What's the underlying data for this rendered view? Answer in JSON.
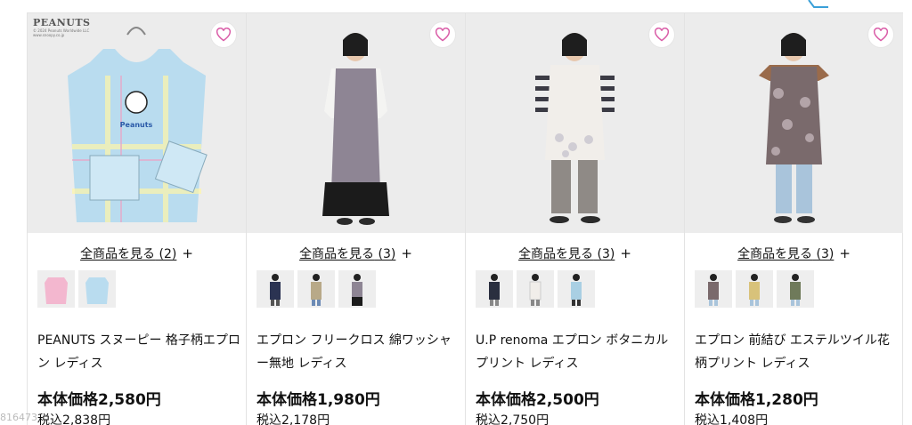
{
  "colors": {
    "heart": "#d95aa6",
    "border": "#e3e3e3"
  },
  "products": [
    {
      "id_key": "peanuts",
      "logo_text": "PEANUTS",
      "logo_sub": "© 2024 Peanuts Worldwide LLC\nwww.snoopy.co.jp",
      "view_all_label": "全商品を見る",
      "view_all_count": "(2)",
      "plus": "+",
      "name": "PEANUTS スヌーピー 格子柄エプロン レディス",
      "price": "本体価格2,580円",
      "tax_price": "税込2,838円",
      "thumb_count": 2
    },
    {
      "id_key": "freecross",
      "view_all_label": "全商品を見る",
      "view_all_count": "(3)",
      "plus": "+",
      "name": "エプロン フリークロス 綿ワッシャー無地 レディス",
      "price": "本体価格1,980円",
      "tax_price": "税込2,178円",
      "thumb_count": 3
    },
    {
      "id_key": "renoma",
      "view_all_label": "全商品を見る",
      "view_all_count": "(3)",
      "plus": "+",
      "name": "U.P renoma エプロン ボタニカルプリント レディス",
      "price": "本体価格2,500円",
      "tax_price": "税込2,750円",
      "thumb_count": 3
    },
    {
      "id_key": "floral",
      "view_all_label": "全商品を見る",
      "view_all_count": "(3)",
      "plus": "+",
      "name": "エプロン 前結び エステルツイル花柄プリント レディス",
      "price": "本体価格1,280円",
      "tax_price": "税込1,408円",
      "thumb_count": 3
    }
  ],
  "overlay_id": "816473"
}
